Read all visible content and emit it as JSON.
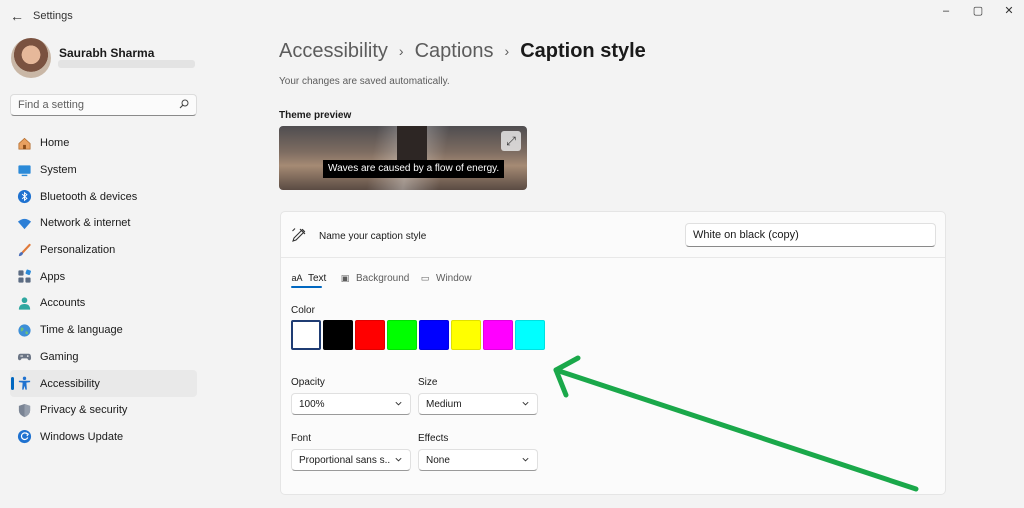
{
  "window": {
    "app_title": "Settings",
    "back_glyph": "←",
    "minimize_glyph": "–",
    "maximize_glyph": "▢",
    "close_glyph": "✕"
  },
  "user": {
    "name": "Saurabh Sharma"
  },
  "search": {
    "placeholder": "Find a setting",
    "icon": "search-icon"
  },
  "sidebar": {
    "items": [
      {
        "label": "Home",
        "icon": "home-icon"
      },
      {
        "label": "System",
        "icon": "system-icon"
      },
      {
        "label": "Bluetooth & devices",
        "icon": "bluetooth-icon"
      },
      {
        "label": "Network & internet",
        "icon": "wifi-icon"
      },
      {
        "label": "Personalization",
        "icon": "brush-icon"
      },
      {
        "label": "Apps",
        "icon": "apps-icon"
      },
      {
        "label": "Accounts",
        "icon": "person-icon"
      },
      {
        "label": "Time & language",
        "icon": "globe-icon"
      },
      {
        "label": "Gaming",
        "icon": "gamepad-icon"
      },
      {
        "label": "Accessibility",
        "icon": "accessibility-icon",
        "active": true
      },
      {
        "label": "Privacy & security",
        "icon": "shield-icon"
      },
      {
        "label": "Windows Update",
        "icon": "update-icon"
      }
    ]
  },
  "breadcrumb": {
    "items": [
      "Accessibility",
      "Captions"
    ],
    "current": "Caption style",
    "separator": "›"
  },
  "status": {
    "autosave": "Your changes are saved automatically."
  },
  "preview": {
    "label": "Theme preview",
    "caption": "Waves are caused by a flow of energy.",
    "expand_glyph": "⤢"
  },
  "caption_style": {
    "name_label": "Name your caption style",
    "name_value": "White on black (copy)",
    "tabs": [
      {
        "label": "Text",
        "icon_glyph": "aA",
        "active": true
      },
      {
        "label": "Background",
        "icon_glyph": "▣"
      },
      {
        "label": "Window",
        "icon_glyph": "▭"
      }
    ],
    "color_label": "Color",
    "colors": [
      "#ffffff",
      "#000000",
      "#ff0000",
      "#00ff00",
      "#0000ff",
      "#ffff00",
      "#ff00ff",
      "#00ffff"
    ],
    "selected_color_index": 0,
    "opacity": {
      "label": "Opacity",
      "value": "100%"
    },
    "size": {
      "label": "Size",
      "value": "Medium"
    },
    "font": {
      "label": "Font",
      "value": "Proportional sans s..."
    },
    "effects": {
      "label": "Effects",
      "value": "None"
    }
  },
  "theme": {
    "accent": "#0067c0",
    "annotation_arrow": "#1aa84a"
  }
}
